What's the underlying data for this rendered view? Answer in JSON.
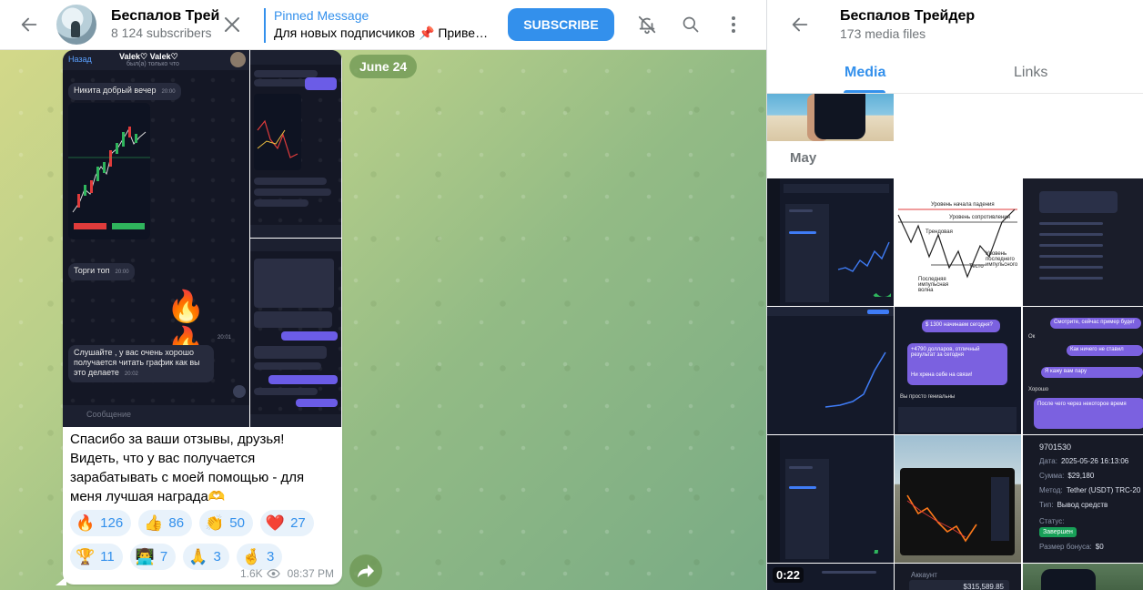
{
  "header": {
    "channel_title": "Беспалов Трей",
    "subscribers": "8 124 subscribers",
    "pinned_label": "Pinned Message",
    "pinned_text": "Для новых подписчиков 📌 Приве…",
    "subscribe_label": "SUBSCRIBE"
  },
  "chat": {
    "date_pill": "June 24",
    "screenshot": {
      "back": "Назад",
      "title": "Valek♡ Valek♡",
      "subtitle": "был(а) только что",
      "msg1": "Никита добрый вечер",
      "msg1_time": "20:00",
      "msg2": "Торги топ",
      "msg2_time": "20:00",
      "fire": "🔥🔥",
      "fire_time": "20:01",
      "msg3": "Слушайте , у вас очень хорошо получается читать график как вы это делаете",
      "msg3_time": "20:02",
      "input_placeholder": "Сообщение"
    },
    "message_text": "Спасибо за ваши отзывы, друзья! Видеть, что у вас получается зарабатывать с моей помощью - для меня лучшая награда🫶",
    "reactions": [
      {
        "emoji": "🔥",
        "count": "126"
      },
      {
        "emoji": "👍",
        "count": "86"
      },
      {
        "emoji": "👏",
        "count": "50"
      },
      {
        "emoji": "❤️",
        "count": "27"
      },
      {
        "emoji": "🏆",
        "count": "11"
      },
      {
        "emoji": "👨‍💻",
        "count": "7"
      },
      {
        "emoji": "🙏",
        "count": "3"
      },
      {
        "emoji": "🤞",
        "count": "3"
      }
    ],
    "views": "1.6K",
    "time": "08:37 PM"
  },
  "side_panel": {
    "title": "Беспалов Трейдер",
    "subtitle": "173 media files",
    "tabs": [
      "Media",
      "Links"
    ],
    "section_label": "May",
    "video_duration": "0:22",
    "receipt": {
      "id": "9701530",
      "date_label": "Дата:",
      "date": "2025-05-26 16:13:06",
      "sum_label": "Сумма:",
      "sum": "$29,180",
      "method_label": "Метод:",
      "method": "Tether (USDT) TRC-20",
      "type_label": "Тип:",
      "type": "Вывод средств",
      "status_label": "Статус:",
      "status": "Завершен",
      "bonus_label": "Размер бонуса:",
      "bonus": "$0"
    },
    "diagram": {
      "resistance_top": "Уровень начала падения",
      "resistance": "Уровень сопротивления",
      "trend": "Трендовая",
      "last_impulse": "Уровень последнего импульсного",
      "texts": "Тесто",
      "impulse_wave": "Последняя импульсная волна"
    },
    "chat_snippets": [
      "$ 1300 начинаем сегодня?",
      "+4790 долларов, отличный результат за сегодня",
      "Ни хрена себе на связи!",
      "Вы просто гениальны",
      "Смотрите, сейчас пример будет",
      "Ок",
      "Как ничего не ставил",
      "Я кажу вам пару",
      "Хорошо",
      "После чего через некоторое время"
    ],
    "account_label": "Аккаунт",
    "account_value": "$315,589.85"
  },
  "colors": {
    "accent": "#3390ec",
    "reaction_bg": "#e8f2fb",
    "chat_bg_start": "#d3d889",
    "chat_bg_end": "#79ab85"
  }
}
